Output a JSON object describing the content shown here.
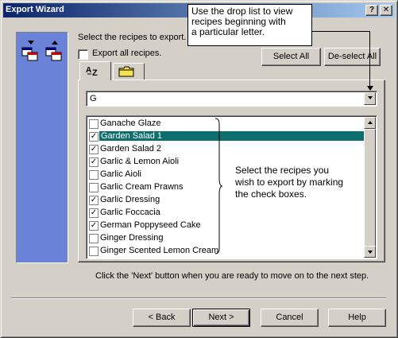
{
  "window": {
    "title": "Export Wizard",
    "help_glyph": "?",
    "close_glyph": "✕"
  },
  "callout": {
    "text_line1": "Use the drop list to view",
    "text_line2": "recipes beginning with",
    "text_line3": "a particular letter."
  },
  "instructions": {
    "select_recipes": "Select the recipes to export.",
    "export_all": "Export all recipes.",
    "next_hint": "Click the 'Next' button when you are ready to move on to the next step."
  },
  "buttons": {
    "select_all": "Select All",
    "deselect_all": "De-select All",
    "back": "< Back",
    "next": "Next >",
    "cancel": "Cancel",
    "help": "Help"
  },
  "tabs": [
    {
      "icon": "az-sort-icon",
      "active": true
    },
    {
      "icon": "folder-icon",
      "active": false
    }
  ],
  "letter_filter": {
    "value": "G"
  },
  "annotation": {
    "line1": "Select the recipes you",
    "line2": "wish to export by marking",
    "line3": "the check boxes."
  },
  "recipes": [
    {
      "name": "Ganache Glaze",
      "checked": false,
      "selected": false
    },
    {
      "name": "Garden Salad 1",
      "checked": true,
      "selected": true
    },
    {
      "name": "Garden Salad 2",
      "checked": true,
      "selected": false
    },
    {
      "name": "Garlic & Lemon Aioli",
      "checked": true,
      "selected": false
    },
    {
      "name": "Garlic Aioli",
      "checked": false,
      "selected": false
    },
    {
      "name": "Garlic Cream Prawns",
      "checked": false,
      "selected": false
    },
    {
      "name": "Garlic Dressing",
      "checked": true,
      "selected": false
    },
    {
      "name": "Garlic Foccacia",
      "checked": true,
      "selected": false
    },
    {
      "name": "German Poppyseed Cake",
      "checked": true,
      "selected": false
    },
    {
      "name": "Ginger Dressing",
      "checked": false,
      "selected": false
    },
    {
      "name": "Ginger Scented Lemon Cream",
      "checked": false,
      "selected": false
    }
  ],
  "colors": {
    "selection": "#0d6e6e",
    "side_panel": "#6a82d8",
    "title_start": "#0a246a",
    "title_end": "#a6caf0"
  }
}
